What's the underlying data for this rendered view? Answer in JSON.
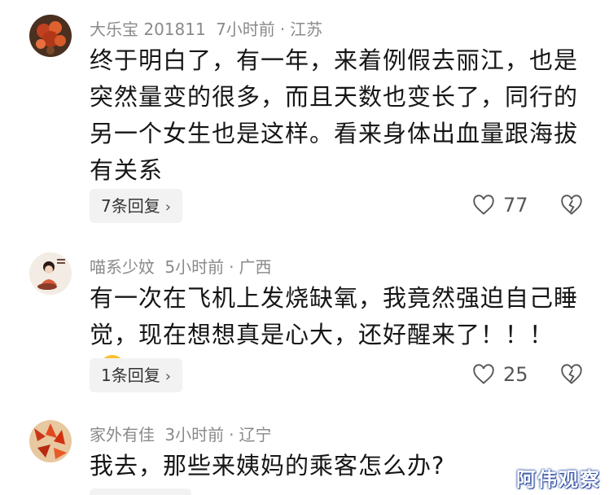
{
  "comments": [
    {
      "username": "大乐宝 201811",
      "time": "7小时前",
      "location": "江苏",
      "lines": [
        "终于明白了，有一年，来着例假去丽江，也是",
        "突然量变的很多，而且天数也变长了，同行的",
        "另一个女生也是这样。看来身体出血量跟海拔",
        "有关系"
      ],
      "reply_label": "7条回复",
      "likes": "77"
    },
    {
      "username": "喵系少妏",
      "time": "5小时前",
      "location": "广西",
      "lines": [
        "有一次在飞机上发烧缺氧，我竟然强迫自己睡",
        "觉，现在想想真是心大，还好醒来了！！！"
      ],
      "reply_label": "1条回复",
      "likes": "25"
    },
    {
      "username": "家外有佳",
      "time": "3小时前",
      "location": "辽宁",
      "lines": [
        "我去，那些来姨妈的乘客怎么办?"
      ]
    }
  ],
  "separator": "·",
  "watermark": "阿伟观察",
  "colors": {
    "meta": "#8a8a8a",
    "text": "#161616",
    "reply_bg": "#f2f2f2"
  }
}
